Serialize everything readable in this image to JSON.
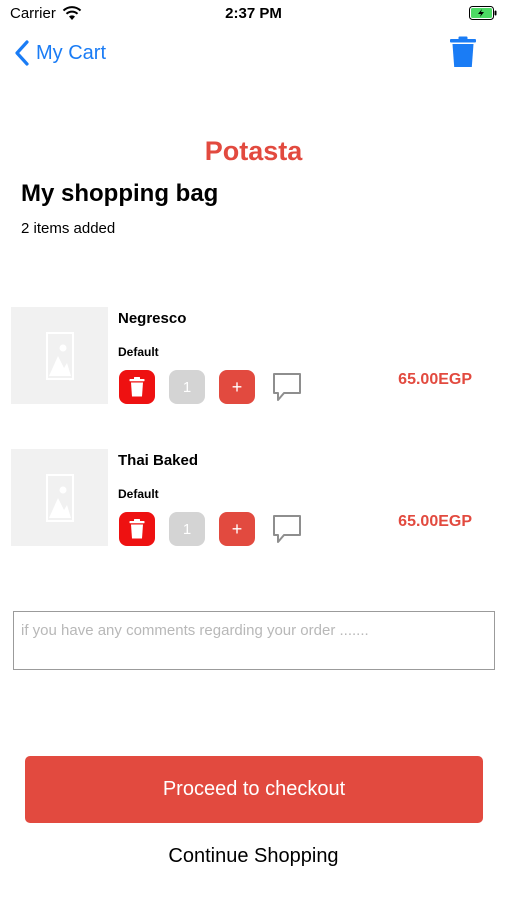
{
  "status_bar": {
    "carrier": "Carrier",
    "time": "2:37 PM",
    "icons": [
      "wifi-icon",
      "battery-charging-icon"
    ]
  },
  "nav": {
    "back_label": "My Cart",
    "back_icon": "chevron-left-icon",
    "action_icon": "trash-icon"
  },
  "brand": "Potasta",
  "title": "My shopping bag",
  "subtitle": "2 items added",
  "items": [
    {
      "name": "Negresco",
      "variant": "Default",
      "quantity": "1",
      "plus": "+",
      "price": "65.00EGP"
    },
    {
      "name": "Thai Baked",
      "variant": "Default",
      "quantity": "1",
      "plus": "+",
      "price": "65.00EGP"
    }
  ],
  "comment": {
    "placeholder": "if you have any comments regarding your order ......."
  },
  "actions": {
    "checkout": "Proceed to checkout",
    "continue": "Continue Shopping"
  },
  "colors": {
    "accent": "#e24a3f",
    "link": "#1a7cf5",
    "nav_icon": "#1a7cf5",
    "delete": "#ee1111"
  }
}
